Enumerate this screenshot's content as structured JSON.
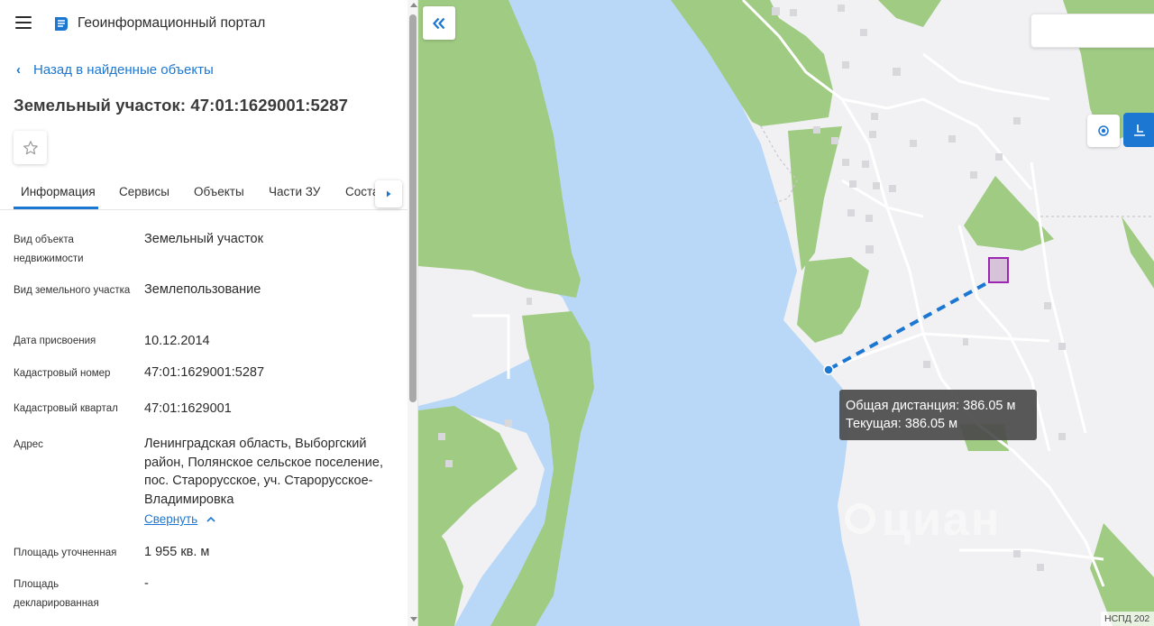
{
  "header": {
    "portal_title": "Геоинформационный портал"
  },
  "navigation": {
    "back_label": "Назад в найденные объекты"
  },
  "object": {
    "title": "Земельный участок: 47:01:1629001:5287"
  },
  "tabs": [
    {
      "label": "Информация",
      "active": true
    },
    {
      "label": "Сервисы",
      "active": false
    },
    {
      "label": "Объекты",
      "active": false
    },
    {
      "label": "Части ЗУ",
      "active": false
    },
    {
      "label": "Соста",
      "active": false
    }
  ],
  "properties": [
    {
      "label": "Вид объекта недвижимости",
      "value": "Земельный участок"
    },
    {
      "label": "Вид земельного участка",
      "value": "Землепользование"
    },
    {
      "label": "Дата присвоения",
      "value": "10.12.2014"
    },
    {
      "label": "Кадастровый номер",
      "value": "47:01:1629001:5287"
    },
    {
      "label": "Кадастровый квартал",
      "value": "47:01:1629001"
    },
    {
      "label": "Адрес",
      "value": "Ленинградская область, Выборгский район, Полянское сельское поселение, пос. Старорусское, уч. Старорусское-Владимировка"
    },
    {
      "label": "Площадь уточненная",
      "value": "1 955 кв. м"
    },
    {
      "label": "Площадь декларированная",
      "value": "-"
    }
  ],
  "address_toggle": {
    "label": "Свернуть"
  },
  "map": {
    "tooltip": {
      "total_distance": "Общая дистанция: 386.05 м",
      "current_distance": "Текущая: 386.05 м"
    },
    "attribution": "НСПД 202",
    "watermark": "циан",
    "colors": {
      "water": "#b9d8f7",
      "forest": "#a0cb83",
      "land": "#f1f1f3",
      "accent": "#1b77d2",
      "parcel_border": "#9c27b0"
    }
  }
}
